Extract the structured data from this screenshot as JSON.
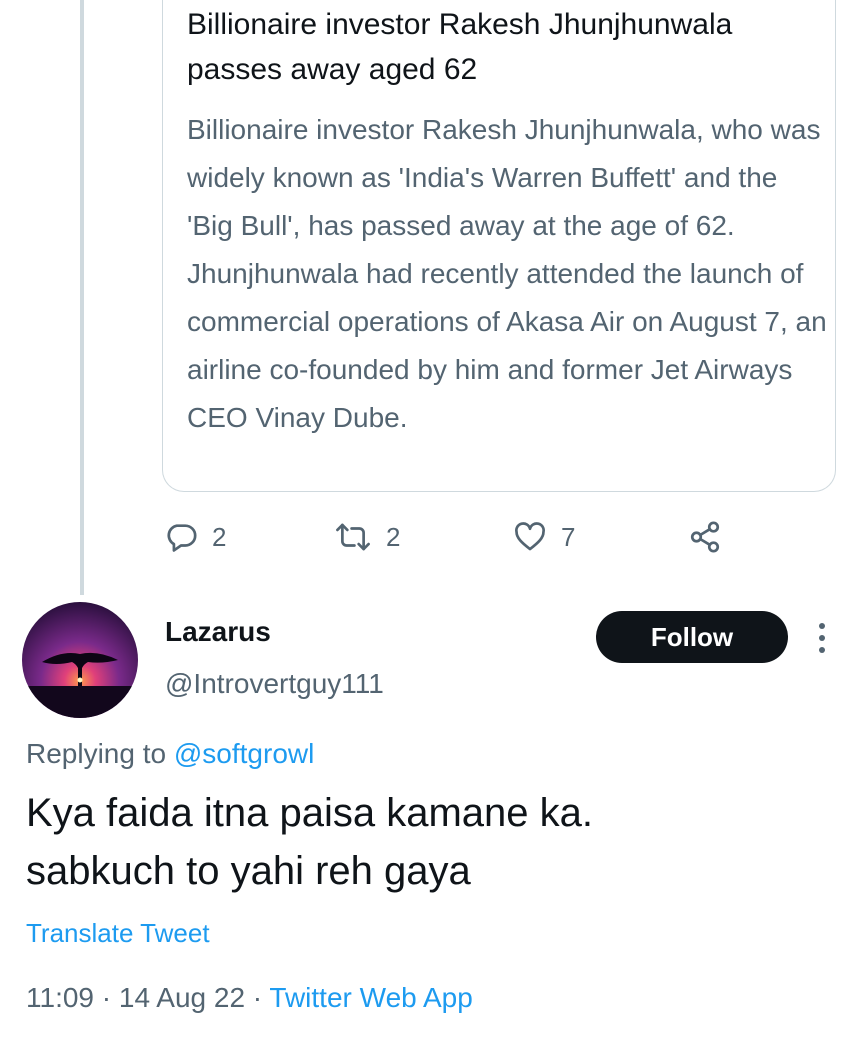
{
  "link_card": {
    "title": "Billionaire investor Rakesh Jhunjhunwala passes away aged 62",
    "description": "Billionaire investor Rakesh Jhunjhunwala, who was widely known as 'India's Warren Buffett' and the 'Big Bull', has passed away at the age of 62. Jhunjhunwala had recently attended the launch of commercial operations of Akasa Air on August 7, an airline co-founded by him and former Jet Airways CEO Vinay Dube."
  },
  "actions": {
    "reply_icon": "reply-icon",
    "reply_count": "2",
    "retweet_icon": "retweet-icon",
    "retweet_count": "2",
    "like_icon": "heart-icon",
    "like_count": "7",
    "share_icon": "share-icon"
  },
  "reply": {
    "display_name": "Lazarus",
    "handle": "@Introvertguy111",
    "follow_label": "Follow",
    "more_icon": "more-vertical-icon",
    "replying_prefix": "Replying to",
    "replying_to": "@softgrowl",
    "text_line1": "Kya faida itna paisa kamane ka.",
    "text_line2": "sabkuch to yahi reh gaya",
    "translate_label": "Translate Tweet",
    "time": "11:09",
    "date": "14 Aug 22",
    "source": "Twitter Web App",
    "separator": "·"
  },
  "colors": {
    "text_primary": "#0f1419",
    "text_secondary": "#536471",
    "link_blue": "#1d9bf0",
    "border": "#cfd9de",
    "button_dark": "#0f1419"
  }
}
